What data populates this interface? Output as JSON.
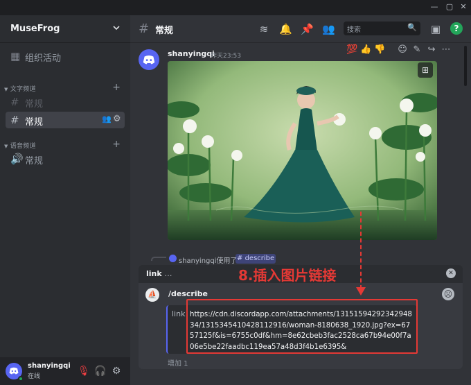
{
  "window": {
    "controls": [
      "minimize",
      "maximize",
      "close"
    ]
  },
  "server": {
    "name": "MuseFrog"
  },
  "sidebar": {
    "events": "组织活动",
    "text_category": "文字频道",
    "channels_text": [
      {
        "name": "常规",
        "state": "muted"
      },
      {
        "name": "常规",
        "state": "active"
      }
    ],
    "voice_category": "语音频道",
    "channels_voice": [
      {
        "name": "常规"
      }
    ]
  },
  "user": {
    "name": "shanyingqi",
    "status": "在线"
  },
  "header": {
    "channel_name": "常规",
    "search_placeholder": "搜索"
  },
  "message": {
    "author": "shanyingqi",
    "time": "昨天23:53",
    "reactions": [
      "💯",
      "👍",
      "👎"
    ]
  },
  "interaction": {
    "user": "shanyingqi使用了",
    "command": "describe"
  },
  "overlay": {
    "label": "link",
    "ellipsis": "…"
  },
  "command": {
    "name": "/describe",
    "option_label": "link",
    "option_value": "https://cdn.discordapp.com/attachments/1315159429234294834/1315345410428112916/woman-8180638_1920.jpg?ex=6757125f&is=6755c0df&hm=8e62cbeb3fac2528ca67b94e00f7a06e5be22faadbc119ea57a48d3f4b1e6395&",
    "more": "增加 1"
  },
  "annotation": {
    "text": "8.插入图片链接",
    "color": "#e53935"
  },
  "colors": {
    "accent": "#5865f2",
    "online": "#23a55a"
  }
}
